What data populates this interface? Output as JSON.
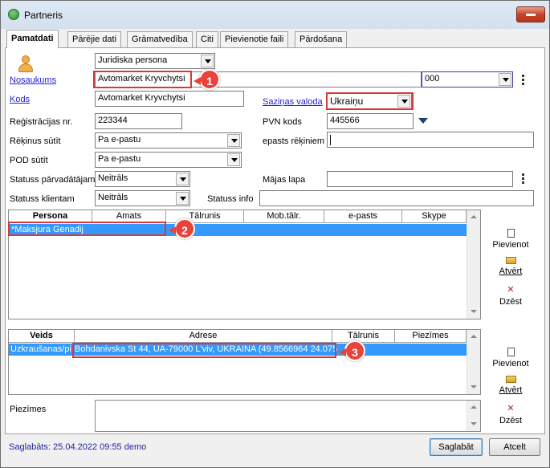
{
  "window": {
    "title": "Partneris"
  },
  "tabs": [
    "Pamatdati",
    "Pārējie dati",
    "Grāmatvedība",
    "Citi",
    "Pievienotie faili",
    "Pārdošana"
  ],
  "form": {
    "partner_type": "Juridiska persona",
    "name_label": "Nosaukums",
    "name_value": "Avtomarket Kryvchytsi",
    "name_code_select": "000",
    "code_label": "Kods",
    "code_value": "Avtomarket Kryvchytsi",
    "contact_lang_label": "Saziņas valoda",
    "contact_lang_value": "Ukraiņu",
    "reg_label": "Reģistrācijas nr.",
    "reg_value": "223344",
    "vat_label": "PVN kods",
    "vat_value": "445566",
    "send_invoices_label": "Rēķinus sūtīt",
    "send_invoices_value": "Pa e-pastu",
    "email_invoices_label": "epasts rēķiniem",
    "email_invoices_value": "",
    "pod_label": "POD sūtīt",
    "pod_value": "Pa e-pastu",
    "status_seller_label": "Statuss pārvadātājam",
    "status_seller_value": "Neitrāls",
    "homepage_label": "Mājas lapa",
    "homepage_value": "",
    "status_client_label": "Statuss klientam",
    "status_client_value": "Neitrāls",
    "status_info_label": "Statuss info",
    "status_info_value": ""
  },
  "persons_grid": {
    "columns": [
      "Persona",
      "Amats",
      "Tālrunis",
      "Mob.tālr.",
      "e-pasts",
      "Skype"
    ],
    "rows": [
      {
        "persona": "*Maksjura Genadij"
      }
    ]
  },
  "address_grid": {
    "columns": [
      "Veids",
      "Adrese",
      "Tālrunis",
      "Piezīmes"
    ],
    "rows": [
      {
        "veids": "Uzkraušanas/pi",
        "adrese": "Bohdanivska St 44, UA-79000 L'viv, UKRAINA (49.8566964 24.075"
      }
    ]
  },
  "side_buttons": {
    "add": "Pievienot",
    "open": "Atvērt",
    "delete": "Dzēst"
  },
  "notes_label": "Piezīmes",
  "footer": {
    "saved_text": "Saglabāts: 25.04.2022 09:55 demo",
    "save_button": "Saglabāt",
    "cancel_button": "Atcelt"
  },
  "annotations": [
    "1",
    "2",
    "3"
  ],
  "colors": {
    "highlight": "#d93838",
    "selection": "#3399ff"
  }
}
